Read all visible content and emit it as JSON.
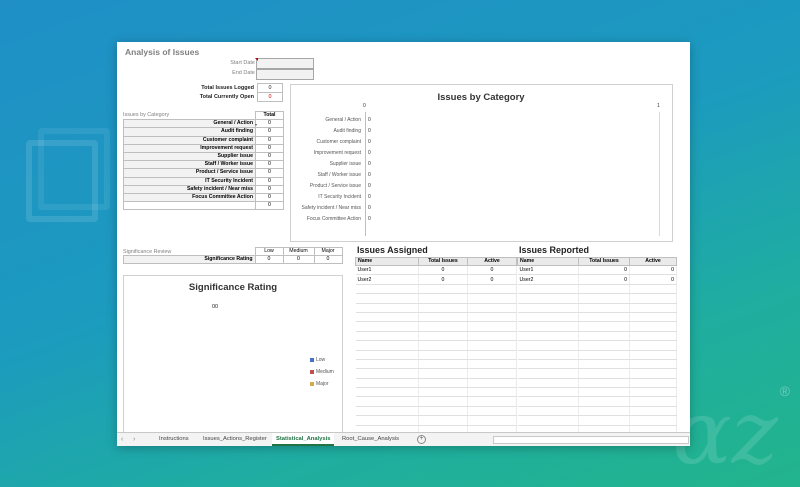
{
  "header": {
    "title": "Analysis of Issues",
    "start_label": "Start Date",
    "end_label": "End Date"
  },
  "totals": {
    "logged_label": "Total Issues Logged",
    "logged_value": "0",
    "open_label": "Total Currently Open",
    "open_value": "0"
  },
  "category_table": {
    "section_label": "Issues by Category",
    "total_header": "Total",
    "rows": [
      {
        "name": "General / Action",
        "value": "0"
      },
      {
        "name": "Audit finding",
        "value": "0"
      },
      {
        "name": "Customer complaint",
        "value": "0"
      },
      {
        "name": "Improvement request",
        "value": "0"
      },
      {
        "name": "Supplier issue",
        "value": "0"
      },
      {
        "name": "Staff / Worker issue",
        "value": "0"
      },
      {
        "name": "Product / Service issue",
        "value": "0"
      },
      {
        "name": "IT Security Incident",
        "value": "0"
      },
      {
        "name": "Safety incident / Near miss",
        "value": "0"
      },
      {
        "name": "Focus Committee Action",
        "value": "0"
      }
    ],
    "grand_total": "0"
  },
  "category_chart": {
    "title": "Issues by Category",
    "axis_min": "0",
    "axis_max": "1",
    "labels": [
      "General / Action",
      "Audit finding",
      "Customer complaint",
      "Improvement request",
      "Supplier issue",
      "Staff / Worker issue",
      "Product / Service issue",
      "IT Security Incident",
      "Safety incident / Near miss",
      "Focus Committee Action"
    ],
    "values": [
      "0",
      "0",
      "0",
      "0",
      "0",
      "0",
      "0",
      "0",
      "0",
      "0"
    ]
  },
  "significance_review": {
    "section_label": "Significance Review",
    "headers": [
      "Low",
      "Medium",
      "Major"
    ],
    "row_label": "Significance Rating",
    "values": [
      "0",
      "0",
      "0"
    ]
  },
  "significance_chart": {
    "title": "Significance Rating",
    "center_text": "00",
    "legend": [
      {
        "label": "Low",
        "color": "#4472c4"
      },
      {
        "label": "Medium",
        "color": "#c0504d"
      },
      {
        "label": "Major",
        "color": "#d4a84b"
      }
    ]
  },
  "issues_assigned": {
    "title": "Issues Assigned",
    "headers": [
      "Name",
      "Total Issues",
      "Active"
    ],
    "rows": [
      {
        "name": "User1",
        "total": "0",
        "active": "0"
      },
      {
        "name": "User2",
        "total": "0",
        "active": "0"
      }
    ]
  },
  "issues_reported": {
    "title": "Issues Reported",
    "headers": [
      "Name",
      "Total Issues",
      "Active"
    ],
    "rows": [
      {
        "name": "User1",
        "total": "0",
        "active": "0"
      },
      {
        "name": "User2",
        "total": "0",
        "active": "0"
      }
    ]
  },
  "tabs": [
    "Instructions",
    "Issues_Actions_Register",
    "Statistical_Analysis",
    "Root_Cause_Analysis"
  ],
  "active_tab": "Statistical_Analysis",
  "add_sheet_symbol": "+"
}
